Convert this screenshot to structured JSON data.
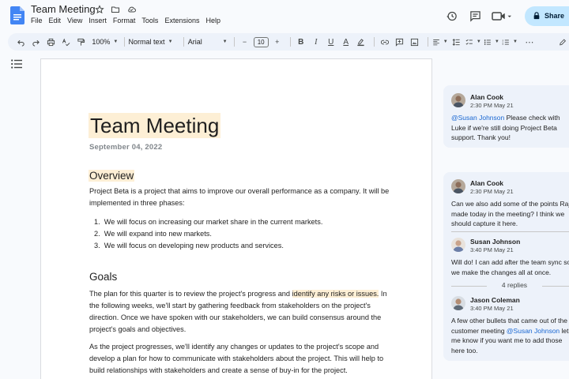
{
  "app": {
    "doc_title": "Team Meeting",
    "menu": [
      "File",
      "Edit",
      "View",
      "Insert",
      "Format",
      "Tools",
      "Extensions",
      "Help"
    ],
    "share_label": "Share",
    "brand_color": "#1a73e8"
  },
  "toolbar": {
    "zoom": "100%",
    "style": "Normal text",
    "font": "Arial",
    "font_size": "10",
    "minus": "−",
    "plus": "+",
    "bold": "B",
    "italic": "I",
    "underline": "U",
    "text_color": "A",
    "more": "⋯"
  },
  "document": {
    "title": "Team Meeting",
    "date": "September 04, 2022",
    "overview_heading": "Overview",
    "overview_text": "Project Beta is a project that aims to improve our overall performance as a company. It will be implemented in three phases:",
    "phases": [
      "We will focus on increasing our market share in the current markets.",
      "We will expand into new markets.",
      "We will focus on developing new products and services."
    ],
    "goals_heading": "Goals",
    "goals_text_before": "The plan for this quarter is to review the project's progress and ",
    "goals_text_highlight": "identify any risks or issues.",
    "goals_text_after": " In the following weeks, we'll start by gathering feedback from stakeholders on the project's direction. Once we have spoken with our stakeholders, we can build consensus around the project's goals and objectives.",
    "progress_text": "As the project progresses, we'll identify any changes or updates to the project's scope and develop a plan for how to communicate with stakeholders about the project. This will help to build relationships with stakeholders and create a sense of buy-in for the project."
  },
  "comments": {
    "thread1": {
      "author": "Alan Cook",
      "time": "2:30 PM May 21",
      "mention": "@Susan Johnson",
      "text": " Please check with Luke if we're still doing Project Beta support. Thank you!"
    },
    "thread2": {
      "c1": {
        "author": "Alan Cook",
        "time": "2:30 PM May 21",
        "text": "Can we also add some of the points Raj made today in the meeting? I think we should capture it here."
      },
      "c2": {
        "author": "Susan Johnson",
        "time": "3:40 PM May 21",
        "text": "Will do! I can add after the team sync so we make the changes all at once."
      },
      "replies_label": "4 replies",
      "c3": {
        "author": "Jason Coleman",
        "time": "3:40 PM May 21",
        "text_before": "A few other bullets that came out of the customer meeting ",
        "mention": "@Susan Johnson",
        "text_after": " let me know if you want me to add those here too."
      }
    }
  }
}
